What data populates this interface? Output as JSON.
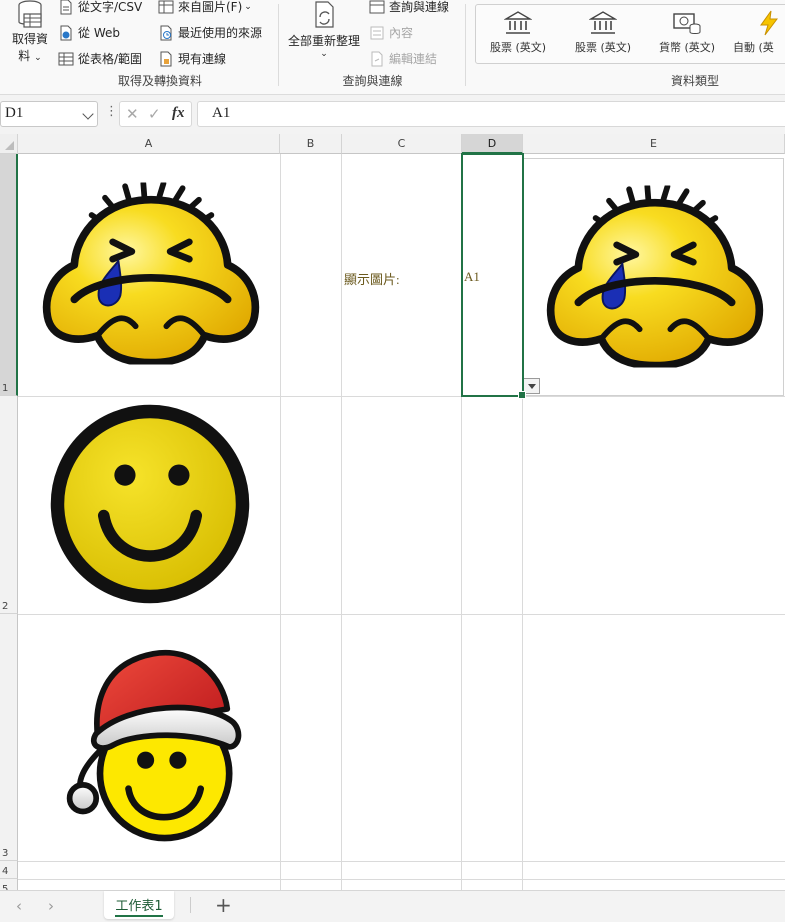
{
  "ribbon": {
    "get_data": {
      "line1": "取得資",
      "line2": "料"
    },
    "from_text_csv": "從文字/CSV",
    "from_web": "從 Web",
    "from_table_range": "從表格/範圍",
    "from_picture": "來自圖片(F)",
    "recent_sources": "最近使用的來源",
    "existing_connections": "現有連線",
    "group_get_transform": "取得及轉換資料",
    "refresh_all": "全部重新整理",
    "queries_connections": "查詢與連線",
    "properties": "內容",
    "edit_links": "編輯連結",
    "group_queries": "查詢與連線",
    "data_types": [
      {
        "label": "股票 (英文)",
        "icon": "bank-icon"
      },
      {
        "label": "股票 (英文)",
        "icon": "bank-icon"
      },
      {
        "label": "貨幣 (英文)",
        "icon": "currency-icon"
      },
      {
        "label": "自動 (英",
        "icon": "lightning-icon"
      }
    ],
    "group_data_types": "資料類型"
  },
  "formula_bar": {
    "name_box": "D1",
    "formula": "A1",
    "cancel_glyph": "✕",
    "enter_glyph": "✓",
    "fx_glyph": "fx",
    "more_glyph": "⋮"
  },
  "grid": {
    "columns": [
      "A",
      "B",
      "C",
      "D",
      "E"
    ],
    "rows": [
      "1",
      "2",
      "3",
      "4",
      "5"
    ],
    "active_column": "D",
    "active_row": "1",
    "cells": {
      "C1": "顯示圖片:",
      "D1": "A1"
    },
    "pictures": [
      {
        "cell": "A1",
        "icon": "crying-face-icon"
      },
      {
        "cell": "A2",
        "icon": "smiley-face-icon"
      },
      {
        "cell": "A3",
        "icon": "santa-hat-smiley-icon"
      },
      {
        "cell": "E1",
        "icon": "crying-face-icon"
      }
    ]
  },
  "sheets": {
    "active": "工作表1",
    "prev_glyph": "‹",
    "next_glyph": "›",
    "add_glyph": "+"
  },
  "colors": {
    "accent": "#217346",
    "face_yellow": "#f5d000",
    "tear_blue": "#1a2fb5",
    "hat_red": "#d82a25"
  }
}
